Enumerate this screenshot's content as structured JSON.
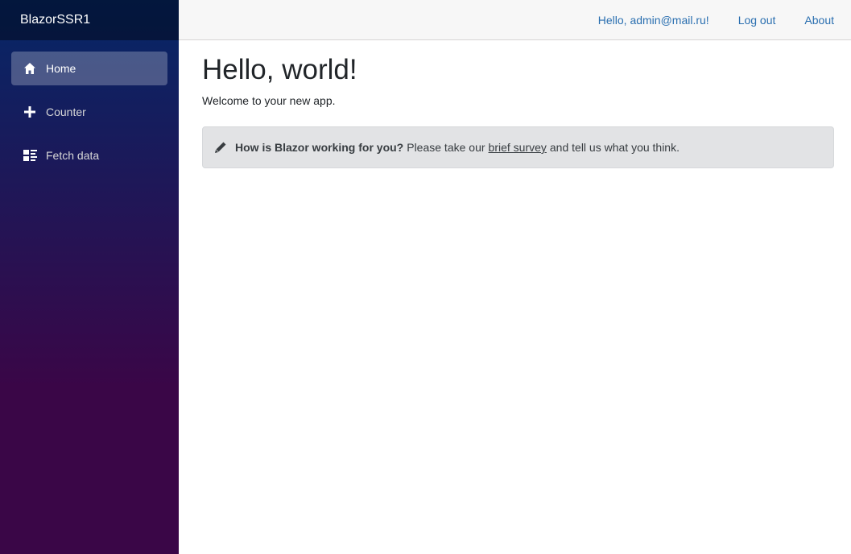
{
  "sidebar": {
    "brand": "BlazorSSR1",
    "items": [
      {
        "label": "Home",
        "icon": "home-icon",
        "active": true
      },
      {
        "label": "Counter",
        "icon": "plus-icon",
        "active": false
      },
      {
        "label": "Fetch data",
        "icon": "list-icon",
        "active": false
      }
    ]
  },
  "header": {
    "greeting": "Hello, admin@mail.ru!",
    "logout": "Log out",
    "about": "About"
  },
  "main": {
    "title": "Hello, world!",
    "welcome": "Welcome to your new app.",
    "survey": {
      "icon": "pencil-icon",
      "question": "How is Blazor working for you?",
      "before_link": "Please take our",
      "link_text": "brief survey",
      "after_link": "and tell us what you think."
    }
  },
  "colors": {
    "sidebar_top": "#052767",
    "sidebar_bottom": "#3a0647",
    "link": "#2a6fb0",
    "alert_bg": "#e2e3e5"
  }
}
